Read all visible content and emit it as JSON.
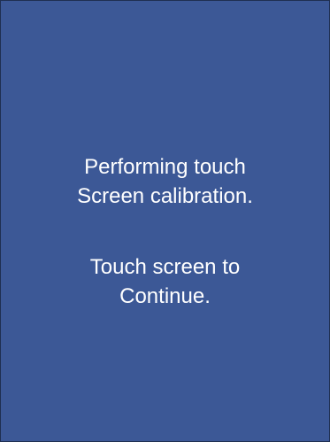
{
  "screen": {
    "background_color": "#3c5896",
    "text_color": "#ffffff",
    "message_1": {
      "line_1": "Performing touch",
      "line_2": "Screen calibration."
    },
    "message_2": {
      "line_1": "Touch screen to",
      "line_2": "Continue."
    }
  }
}
